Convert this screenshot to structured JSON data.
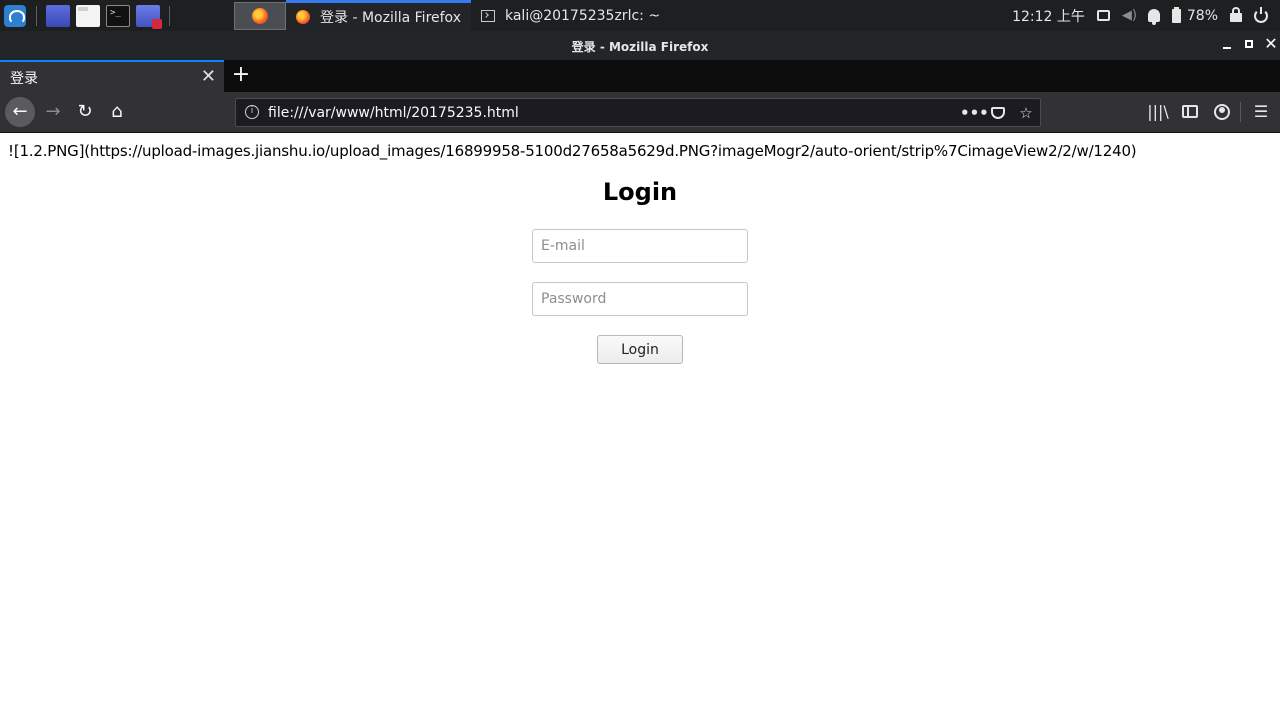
{
  "taskbar": {
    "launchers": [
      "desktop-icon",
      "file-manager-icon",
      "terminal-icon",
      "screen-recorder-icon"
    ],
    "tasks": [
      {
        "label": "登录 - Mozilla Firefox",
        "icon": "firefox-icon"
      },
      {
        "label": "kali@20175235zrlc: ~",
        "icon": "terminal-icon"
      }
    ],
    "clock": "12:12 上午",
    "battery": "78%"
  },
  "window": {
    "title": "登录 - Mozilla Firefox"
  },
  "browser": {
    "tab_label": "登录",
    "tab_close": "✕",
    "new_tab": "+",
    "url": "file:///var/www/html/20175235.html"
  },
  "page": {
    "markdown_line": "![1.2.PNG](https://upload-images.jianshu.io/upload_images/16899958-5100d27658a5629d.PNG?imageMogr2/auto-orient/strip%7CimageView2/2/w/1240)",
    "heading": "Login",
    "email_placeholder": "E-mail",
    "password_placeholder": "Password",
    "button_label": "Login"
  }
}
